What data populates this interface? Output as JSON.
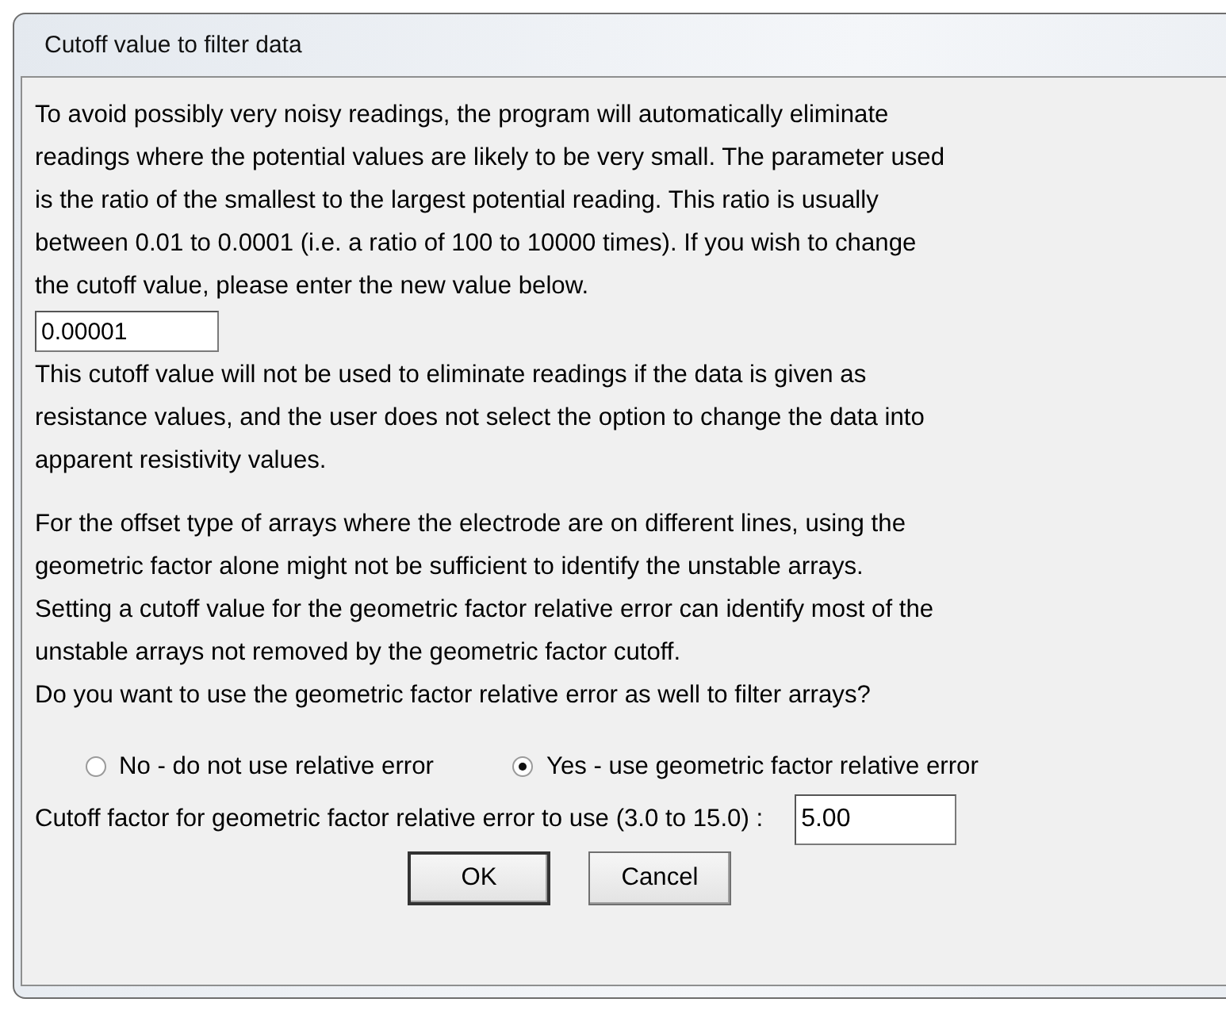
{
  "window": {
    "title": "Cutoff value to filter data"
  },
  "intro": [
    "To avoid possibly very noisy readings, the program will automatically eliminate",
    "readings where the potential values are likely to be very small. The parameter used",
    "is the ratio of the smallest to the largest potential reading. This ratio is usually",
    "between 0.01 to 0.0001 (i.e. a ratio of 100 to 10000 times). If you wish to change",
    "the cutoff value, please enter the new value below."
  ],
  "cutoff_value": "0.00001",
  "note": [
    "This cutoff value will not be used to eliminate readings if the data is given as",
    "resistance values, and the user does not select the option to change the data into",
    "apparent resistivity values."
  ],
  "offset_info": [
    "For the offset type of arrays where the electrode are on different lines, using the",
    "geometric factor alone might not be sufficient to identify the unstable arrays.",
    "Setting a cutoff value for the geometric factor relative error can identify most of the",
    "unstable arrays not removed by the geometric factor cutoff."
  ],
  "question": "Do you want to use the geometric factor relative error as well to filter arrays?",
  "options": [
    {
      "label": "No - do not use relative error",
      "selected": false
    },
    {
      "label": "Yes - use geometric factor relative error",
      "selected": true
    }
  ],
  "factor": {
    "label": "Cutoff factor for geometric factor relative error to use (3.0 to 15.0) :",
    "value": "5.00"
  },
  "buttons": [
    "OK",
    "Cancel"
  ]
}
